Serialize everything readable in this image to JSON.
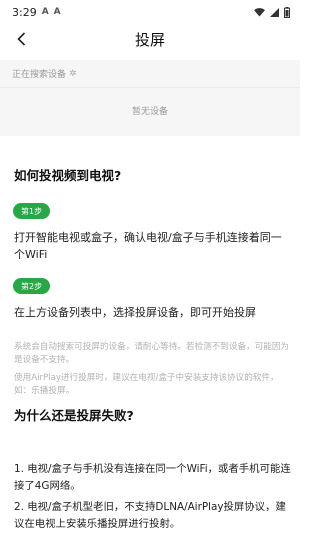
{
  "status_bar": {
    "time": "3:29",
    "notification_icons": [
      "A",
      "A"
    ],
    "right_icons": [
      "wifi-icon",
      "signal-icon",
      "battery-icon"
    ]
  },
  "nav": {
    "back_icon": "chevron-left-icon",
    "title": "投屏"
  },
  "device_search": {
    "status_text": "正在搜索设备",
    "empty_text": "暂无设备"
  },
  "guide": {
    "title": "如何投视频到电视?",
    "steps": [
      {
        "badge": "第1步",
        "text": "打开智能电视或盒子，确认电视/盒子与手机连接着同一个WiFi"
      },
      {
        "badge": "第2步",
        "text": "在上方设备列表中，选择投屏设备，即可开始投屏"
      }
    ],
    "notes": [
      "系统会自动搜索可投屏的设备，请耐心等待。若检测不到设备，可能因为是设备不支持。",
      "使用AirPlay进行投屏时，建议在电视/盒子中安装支持该协议的软件，如：乐播投屏。"
    ]
  },
  "faq": {
    "title": "为什么还是投屏失败?",
    "reasons": [
      "1. 电视/盒子与手机没有连接在同一个WiFi，或者手机可能连接了4G网络。",
      "2. 电视/盒子机型老旧，不支持DLNA/AirPlay投屏协议，建议在电视上安装乐播投屏进行投射。"
    ]
  },
  "colors": {
    "accent_green": "#27a745",
    "panel_bg": "#f6f6f6",
    "muted_text": "#999999"
  }
}
